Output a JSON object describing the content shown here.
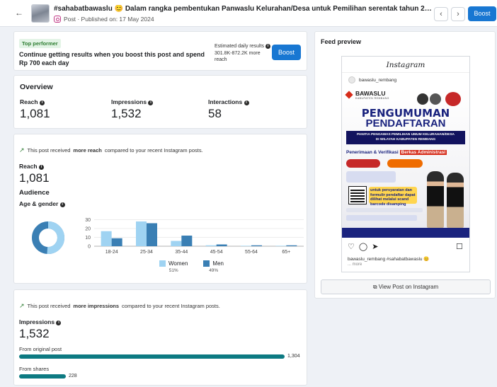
{
  "header": {
    "title": "#sahabatbawaslu 😊 Dalam rangka pembentukan Panwaslu Kelurahan/Desa untuk Pemilihan serentak tahun 2024, Kelom...",
    "meta": "Post · Published on: 17 May 2024",
    "back_icon": "arrow-left-icon",
    "prev_glyph": "‹",
    "next_glyph": "›",
    "boost_label": "Boost"
  },
  "promo": {
    "badge": "Top performer",
    "text": "Continue getting results when you boost this post and spend Rp 700 each day",
    "est_label": "Estimated daily results",
    "est_value": "301.8K-872.2K more reach",
    "boost_label": "Boost"
  },
  "overview": {
    "title": "Overview",
    "metrics": [
      {
        "label": "Reach",
        "value": "1,081"
      },
      {
        "label": "Impressions",
        "value": "1,532"
      },
      {
        "label": "Interactions",
        "value": "58"
      }
    ]
  },
  "reach_section": {
    "insight_pre": "This post received",
    "insight_bold": "more reach",
    "insight_post": "compared to your recent Instagram posts.",
    "reach_label": "Reach",
    "reach_value": "1,081",
    "audience_label": "Audience",
    "age_gender_label": "Age & gender"
  },
  "chart_data": {
    "type": "bar",
    "categories": [
      "18-24",
      "25-34",
      "35-44",
      "45-54",
      "55-64",
      "65+"
    ],
    "series": [
      {
        "name": "Women",
        "values": [
          17,
          28,
          6,
          1,
          0.5,
          0.5
        ],
        "color": "#9fd3f2"
      },
      {
        "name": "Men",
        "values": [
          9,
          26,
          12,
          2,
          1,
          1
        ],
        "color": "#3a7fb4"
      }
    ],
    "y_ticks": [
      0,
      10,
      20,
      30
    ],
    "ylim": [
      0,
      32
    ],
    "legend": [
      {
        "name": "Women",
        "pct": "51%",
        "color": "#9fd3f2"
      },
      {
        "name": "Men",
        "pct": "49%",
        "color": "#3a7fb4"
      }
    ],
    "donut": {
      "women_fraction": 0.51,
      "men_fraction": 0.49
    }
  },
  "impressions_section": {
    "insight_pre": "This post received",
    "insight_bold": "more impressions",
    "insight_post": "compared to your recent Instagram posts.",
    "label": "Impressions",
    "value": "1,532",
    "bars": [
      {
        "label": "From original post",
        "value": 1304,
        "display": "1,304"
      },
      {
        "label": "From shares",
        "value": 228,
        "display": "228"
      }
    ],
    "bar_max": 1304
  },
  "feed": {
    "title": "Feed preview",
    "ig_wordmark": "Instagram",
    "username": "bawaslu_rembang",
    "caption": "bawaslu_rembang #sahabatbawaslu 😊",
    "more": "... more",
    "view_label": "View Post on Instagram"
  },
  "poster": {
    "logo": "BAWASLU",
    "logo_sub": "KABUPATEN REMBANG",
    "heading1": "PENGUMUMAN",
    "heading2": "PENDAFTARAN",
    "banner_line1": "PANITIA PENGAWAS PEMILIHAN UMUM KELURAHAN/DESA",
    "banner_line2": "DI WILAYAH KABUPATEN REMBANG",
    "sub_pre": "Penerimaan & Verifikasi",
    "sub_hl": "Berkas Administrasi",
    "qr_text": "untuk persyaratan dan formulir pendaftar dapat dilihat melalui scand barcode disamping"
  },
  "colors": {
    "accent": "#1877d2",
    "teal_bar": "#0d7a82",
    "women": "#9fd3f2",
    "men": "#3a7fb4"
  }
}
